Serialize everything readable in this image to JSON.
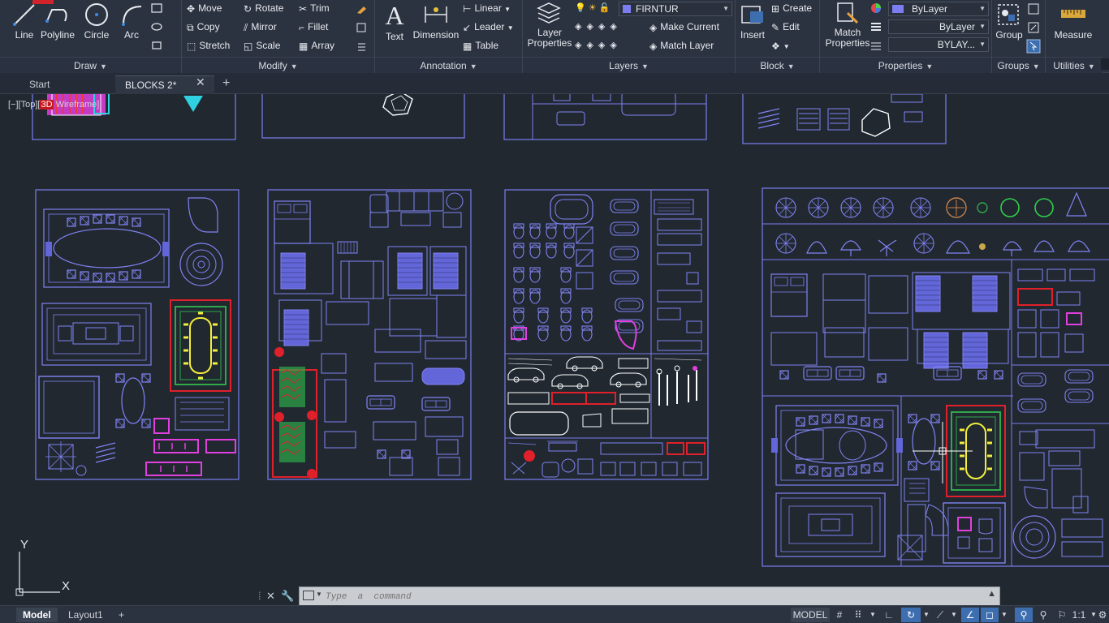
{
  "ribbon": {
    "draw": {
      "title": "Draw",
      "tools": [
        "Line",
        "Polyline",
        "Circle",
        "Arc"
      ]
    },
    "modify": {
      "title": "Modify",
      "tools": [
        "Move",
        "Rotate",
        "Trim",
        "Copy",
        "Mirror",
        "Fillet",
        "Stretch",
        "Scale",
        "Array"
      ]
    },
    "annotation": {
      "title": "Annotation",
      "text": "Text",
      "dimension": "Dimension",
      "linear": "Linear",
      "leader": "Leader",
      "table": "Table"
    },
    "layers": {
      "title": "Layers",
      "layer_properties": "Layer Properties",
      "current_layer": "FIRNTUR",
      "make_current": "Make Current",
      "match_layer": "Match Layer"
    },
    "block": {
      "title": "Block",
      "insert": "Insert",
      "create": "Create",
      "edit": "Edit"
    },
    "properties": {
      "title": "Properties",
      "match_properties": "Match Properties",
      "color": "ByLayer",
      "linetype": "ByLayer",
      "lineweight": "BYLAY..."
    },
    "groups": {
      "title": "Groups",
      "group": "Group"
    },
    "utilities": {
      "title": "Utilities",
      "measure": "Measure"
    }
  },
  "tabs": {
    "start": "Start",
    "drawing": "BLOCKS 2*"
  },
  "viewport": {
    "prefix": "[−][Top][",
    "visual_3d": "3D",
    "suffix": " Wireframe]"
  },
  "ucs": {
    "x_label": "X",
    "y_label": "Y"
  },
  "command": {
    "placeholder": "Type  a  command"
  },
  "statusbar": {
    "model_tab": "Model",
    "layout_tab": "Layout1",
    "model_space": "MODEL",
    "annotation_scale": "1:1"
  },
  "colors": {
    "accent": "#3d6fb0",
    "block_line": "#7b7ef0",
    "highlight_red": "#e0202a",
    "highlight_magenta": "#e040e0",
    "highlight_yellow": "#f2ee3c",
    "highlight_green": "#2fa84a"
  }
}
